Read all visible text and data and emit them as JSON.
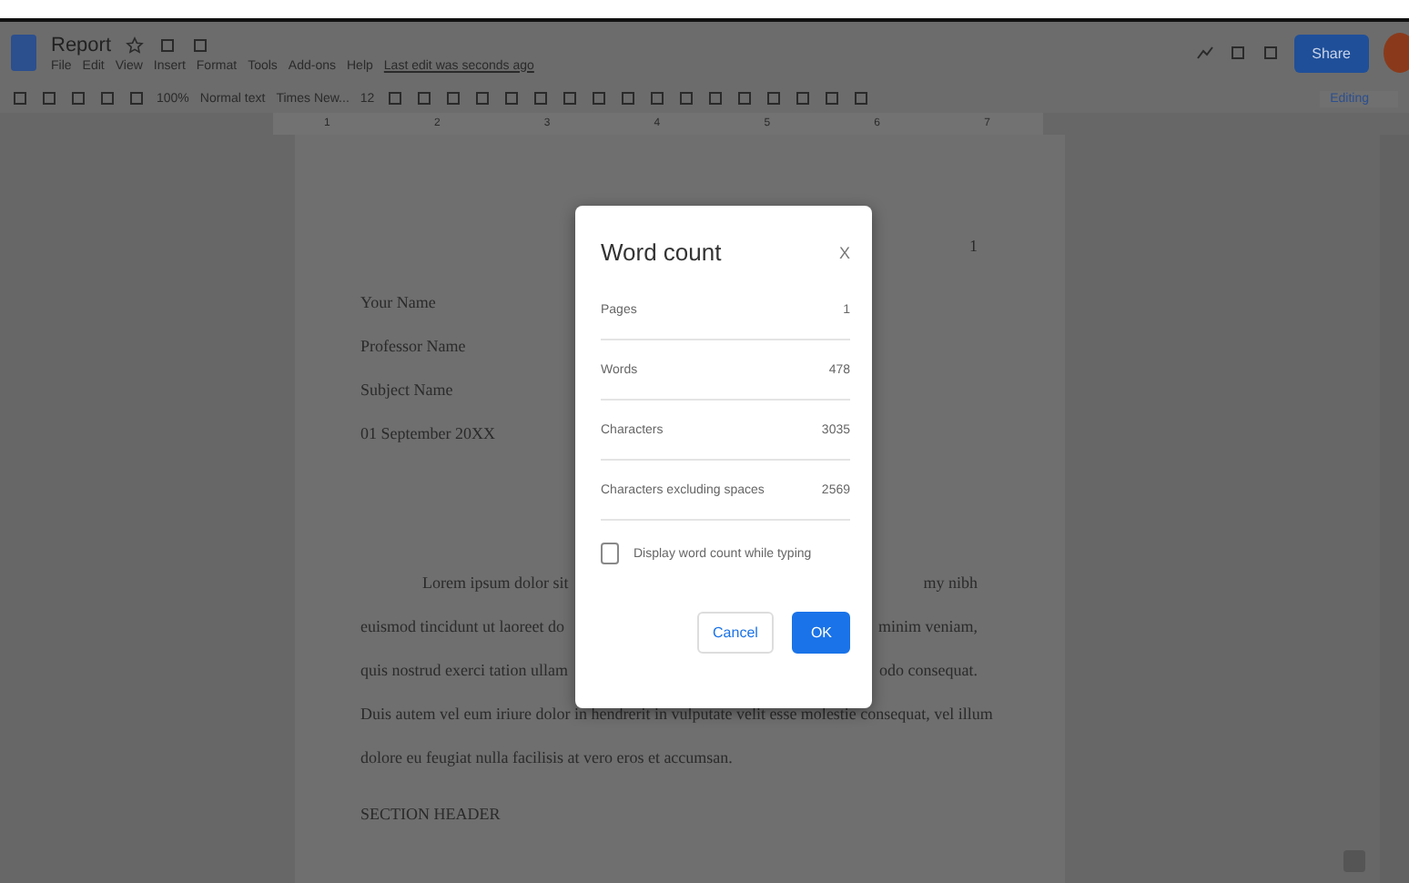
{
  "document": {
    "title": "Report",
    "menu": [
      "File",
      "Edit",
      "View",
      "Insert",
      "Format",
      "Tools",
      "Add-ons",
      "Help"
    ],
    "last_edit": "Last edit was seconds ago"
  },
  "header": {
    "share": "Share"
  },
  "toolbar": {
    "zoom": "100%",
    "style": "Normal text",
    "font": "Times New...",
    "size": "12",
    "mode": "Editing"
  },
  "ruler": [
    "1",
    "2",
    "3",
    "4",
    "5",
    "6",
    "7"
  ],
  "page": {
    "page_number": "1",
    "heading_lines": [
      "Your Name",
      "Professor Name",
      "Subject Name",
      "01 September 20XX"
    ],
    "body_lines": [
      {
        "left": "Lorem ipsum dolor sit",
        "right": "my nibh",
        "indent": true
      },
      {
        "left": "euismod tincidunt ut laoreet do",
        "right": "minim veniam,",
        "indent": false
      },
      {
        "left": "quis nostrud exerci tation ullam",
        "right": "odo consequat.",
        "indent": false
      },
      {
        "left": "Duis autem vel eum iriure dolor in hendrerit in vulputate velit esse molestie consequat, vel illum",
        "indent": false
      },
      {
        "left": "dolore eu feugiat nulla facilisis at vero eros et accumsan.",
        "indent": false
      }
    ],
    "section_header": "SECTION HEADER"
  },
  "dialog": {
    "title": "Word count",
    "close": "X",
    "rows": [
      {
        "label": "Pages",
        "value": "1"
      },
      {
        "label": "Words",
        "value": "478"
      },
      {
        "label": "Characters",
        "value": "3035"
      },
      {
        "label": "Characters excluding spaces",
        "value": "2569"
      }
    ],
    "checkbox": {
      "label": "Display word count while typing",
      "checked": false
    },
    "buttons": [
      {
        "label": "Cancel",
        "kind": "secondary"
      },
      {
        "label": "OK",
        "kind": "primary"
      }
    ]
  }
}
